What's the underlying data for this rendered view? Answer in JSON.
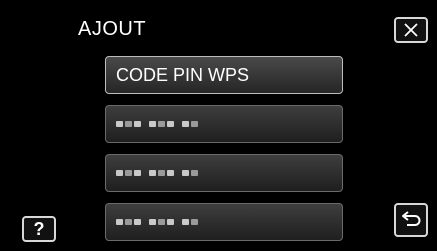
{
  "header": {
    "title": "AJOUT",
    "close_icon": "close-icon"
  },
  "menu": {
    "items": [
      {
        "label": "CODE PIN WPS",
        "enabled": true
      },
      {
        "label": "",
        "enabled": false
      },
      {
        "label": "",
        "enabled": false
      },
      {
        "label": "",
        "enabled": false
      }
    ]
  },
  "footer": {
    "help_label": "?",
    "back_icon": "back-arrow-icon"
  },
  "colors": {
    "background": "#000000",
    "button_border": "#bdbdbd",
    "text": "#ffffff"
  }
}
